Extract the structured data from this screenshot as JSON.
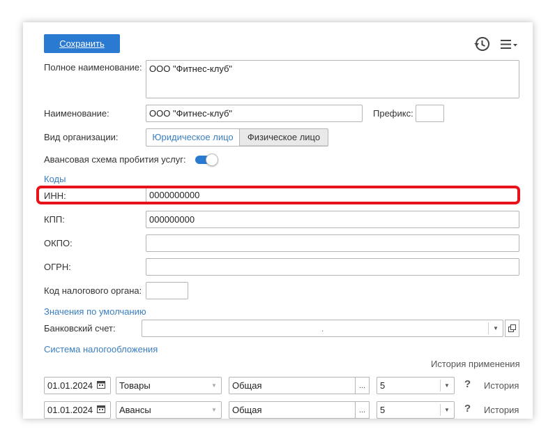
{
  "toolbar": {
    "save_label": "Сохранить",
    "history_icon": "history-icon",
    "menu_icon": "menu-icon"
  },
  "form": {
    "full_name_label": "Полное наименование:",
    "full_name_value": "ООО \"Фитнес-клуб\"",
    "name_label": "Наименование:",
    "name_value": "ООО \"Фитнес-клуб\"",
    "prefix_label": "Префикс:",
    "prefix_value": "",
    "org_type_label": "Вид организации:",
    "org_type_options": [
      "Юридическое лицо",
      "Физическое лицо"
    ],
    "org_type_selected": "Юридическое лицо",
    "advance_label": "Авансовая схема пробития услуг:",
    "advance_enabled": true
  },
  "codes": {
    "section_title": "Коды",
    "inn_label": "ИНН:",
    "inn_value": "0000000000",
    "kpp_label": "КПП:",
    "kpp_value": "000000000",
    "okpo_label": "ОКПО:",
    "okpo_value": "",
    "ogrn_label": "ОГРН:",
    "ogrn_value": "",
    "tax_code_label": "Код налогового органа:",
    "tax_code_value": ""
  },
  "defaults": {
    "section_title": "Значения по умолчанию",
    "bank_label": "Банковский счет:",
    "bank_value": "."
  },
  "tax": {
    "section_title": "Система налогообложения",
    "history_header": "История применения",
    "rows": [
      {
        "date": "01.01.2024",
        "kind": "Товары",
        "system": "Общая",
        "rate": "5",
        "help": "?",
        "history": "История"
      },
      {
        "date": "01.01.2024",
        "kind": "Авансы",
        "system": "Общая",
        "rate": "5",
        "help": "?",
        "history": "История"
      }
    ]
  },
  "colors": {
    "accent": "#2a7ad2",
    "link": "#3a7ec0",
    "highlight": "#e8121b"
  }
}
